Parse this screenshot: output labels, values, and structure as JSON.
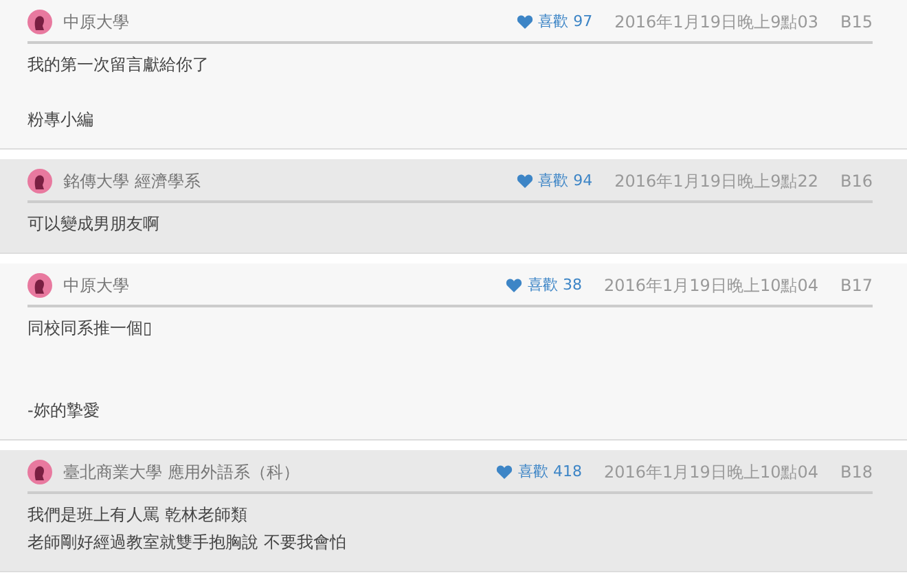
{
  "comments": [
    {
      "author": "中原大學",
      "shaded": false,
      "likes_label": "喜歡 97",
      "time": "2016年1月19日晚上9點03",
      "floor": "B15",
      "body": [
        {
          "kind": "line",
          "text": "我的第一次留言獻給你了"
        },
        {
          "kind": "break"
        },
        {
          "kind": "line",
          "text": "粉專小編"
        }
      ]
    },
    {
      "author": "銘傳大學 經濟學系",
      "shaded": true,
      "likes_label": "喜歡 94",
      "time": "2016年1月19日晚上9點22",
      "floor": "B16",
      "body": [
        {
          "kind": "line",
          "text": "可以變成男朋友啊"
        }
      ]
    },
    {
      "author": "中原大學",
      "shaded": false,
      "likes_label": "喜歡 38",
      "time": "2016年1月19日晚上10點04",
      "floor": "B17",
      "body": [
        {
          "kind": "line",
          "text": "同校同系推一個▯"
        },
        {
          "kind": "break"
        },
        {
          "kind": "break"
        },
        {
          "kind": "line",
          "text": "-妳的摯愛"
        }
      ]
    },
    {
      "author": "臺北商業大學 應用外語系（科）",
      "shaded": true,
      "likes_label": "喜歡 418",
      "time": "2016年1月19日晚上10點04",
      "floor": "B18",
      "body": [
        {
          "kind": "line",
          "text": "我們是班上有人罵 乾林老師類"
        },
        {
          "kind": "line",
          "text": "老師剛好經過教室就雙手抱胸說 不要我會怕"
        }
      ]
    }
  ]
}
